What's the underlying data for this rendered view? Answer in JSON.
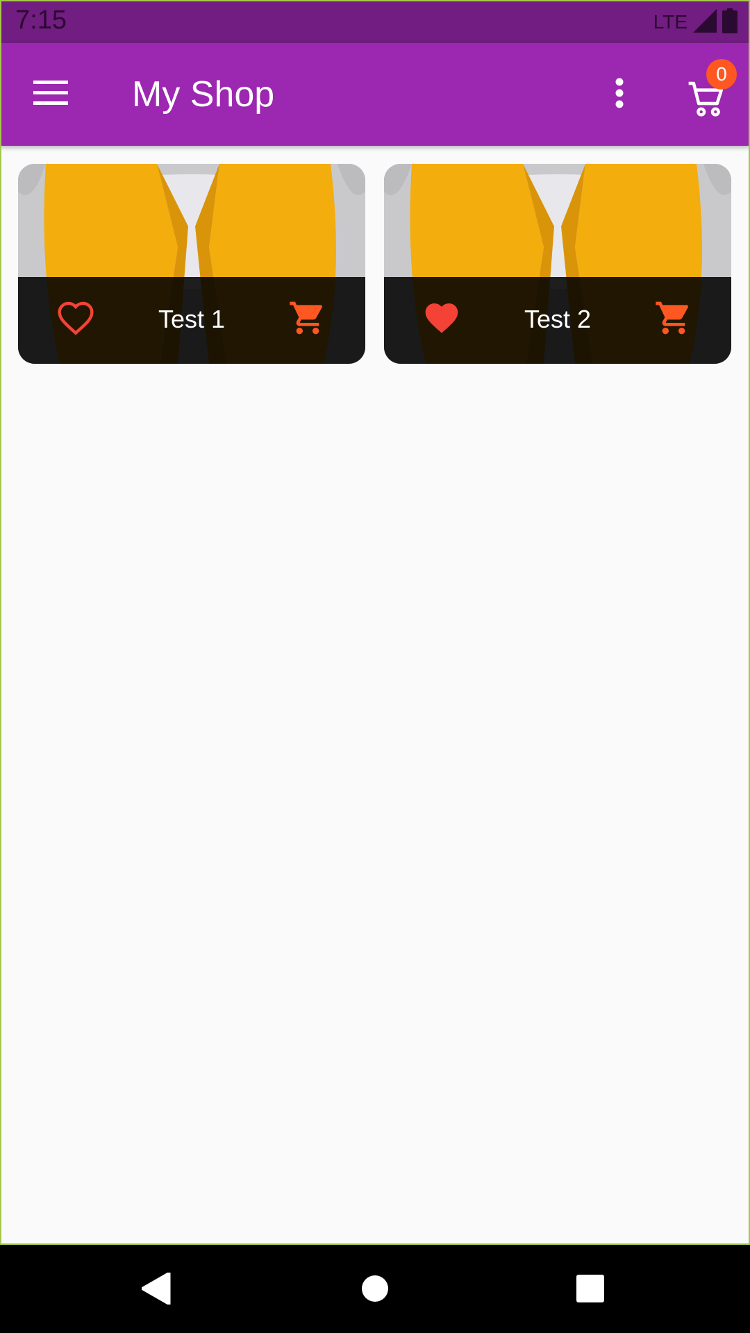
{
  "status_bar": {
    "time": "7:15",
    "network": "LTE",
    "signal_icon": "cell-signal-icon",
    "battery_icon": "battery-icon"
  },
  "app_bar": {
    "title": "My Shop",
    "menu_icon": "hamburger-menu-icon",
    "more_icon": "more-vert-icon",
    "cart_icon": "shopping-cart-icon",
    "cart_badge": "0",
    "color": "#9c27b0"
  },
  "products": [
    {
      "title": "Test 1",
      "favorite": false,
      "favorite_icon": "heart-outline-icon",
      "cart_icon": "add-shopping-cart-icon"
    },
    {
      "title": "Test 2",
      "favorite": true,
      "favorite_icon": "heart-filled-icon",
      "cart_icon": "add-shopping-cart-icon"
    }
  ],
  "nav_bar": {
    "back_icon": "back-triangle-icon",
    "home_icon": "home-circle-icon",
    "recents_icon": "recents-square-icon"
  },
  "colors": {
    "status_bar": "#721d81",
    "accent": "#ff5722",
    "favorite": "#f44336",
    "background": "#fafafa"
  }
}
